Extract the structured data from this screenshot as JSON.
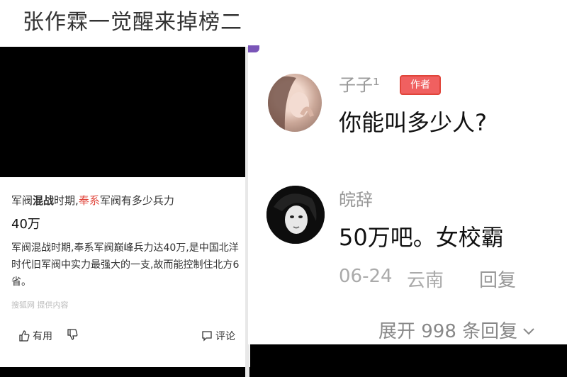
{
  "header": {
    "title": "张作霖一觉醒来掉榜二"
  },
  "left_card": {
    "question_prefix": "军阀",
    "question_bold": "混战",
    "question_mid": "时期,",
    "question_hl": "奉系",
    "question_suffix": "军阀有多少兵力",
    "answer": "40万",
    "description": "军阀混战时期,奉系军阀巅峰兵力达40万,是中国北洋时代旧军阀中实力最强大的一支,故而能控制住北方6省。",
    "source": "搜狐网  提供内容",
    "useful_label": "有用",
    "comment_label": "评论"
  },
  "comments": [
    {
      "username": "子子¹",
      "tag": "作者",
      "text": "你能叫多少人?"
    },
    {
      "username": "皖辞",
      "text": "50万吧。女校霸",
      "date": "06-24",
      "location": "云南",
      "reply_label": "回复"
    }
  ],
  "expand": {
    "label": "展开 998 条回复"
  },
  "colors": {
    "highlight": "#e0443a",
    "tag_bg": "#f06060"
  }
}
